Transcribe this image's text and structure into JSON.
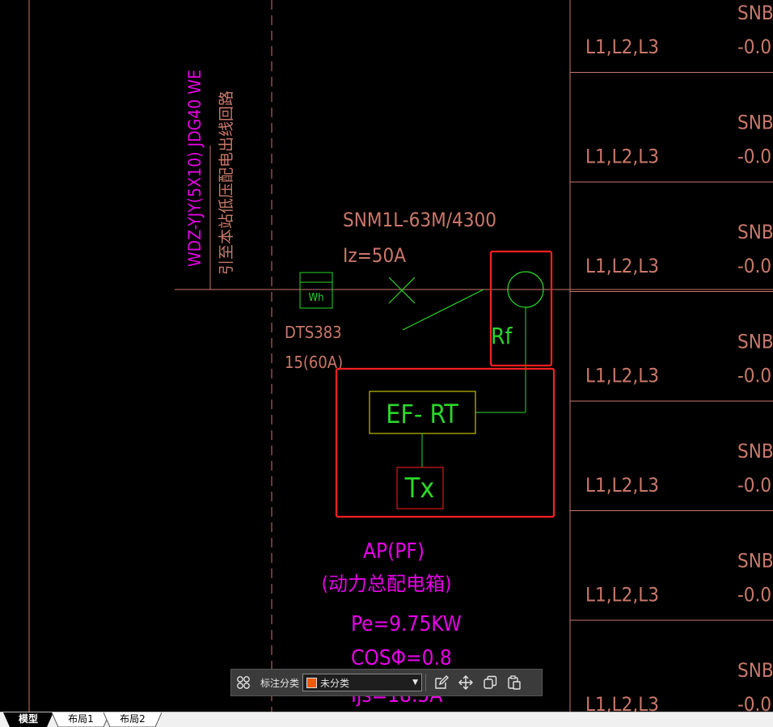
{
  "drawing": {
    "feeder_cable": "WDZ-YJY(5X10) JDG40 WE",
    "feeder_note": "引至本站低压配电出线回路",
    "breaker_model": "SNM1L-63M/4300",
    "breaker_current": "Iz=50A",
    "meter_symbol": "Wh",
    "meter_model": "DTS383",
    "meter_rating": "15(60A)",
    "rf_label": "Rf",
    "efrt_label": "EF- RT",
    "tx_label": "Tx",
    "panel_name": "AP(PF)",
    "panel_desc": "(动力总配电箱)",
    "pe_value": "Pe=9.75KW",
    "cos_value": "COSΦ=0.8",
    "ijs_value": "Ijs=18.5A",
    "branch_rows": [
      {
        "phase": "L1,L2,L3",
        "top": "SNB",
        "bottom": "-0.0"
      },
      {
        "phase": "L1,L2,L3",
        "top": "SNB",
        "bottom": "-0.0"
      },
      {
        "phase": "L1,L2,L3",
        "top": "SNB",
        "bottom": "-0.0"
      },
      {
        "phase": "L1,L2,L3",
        "top": "SNB",
        "bottom": "-0.0"
      },
      {
        "phase": "L1,L2,L3",
        "top": "SNB",
        "bottom": "-0.0"
      },
      {
        "phase": "L1,L2,L3",
        "top": "SNB",
        "bottom": "-0.0"
      },
      {
        "phase": "L1,L2,L3",
        "top": "SNB",
        "bottom": "-0.0"
      }
    ]
  },
  "colors": {
    "background": "#000000",
    "magenta": "#e600e6",
    "brown": "#c8786a",
    "green": "#2bd62b",
    "yellow": "#e6e600",
    "highlight": "#ff2020",
    "swatch": "#f05a0a"
  },
  "toolbar": {
    "grid_icon": "grid-icon",
    "label": "标注分类",
    "category_value": "未分类",
    "edit_icon": "edit-icon",
    "move_icon": "move-icon",
    "copy_icon": "copy-icon",
    "paste_icon": "paste-icon"
  },
  "tabs": [
    {
      "label": "模型",
      "active": true
    },
    {
      "label": "布局1",
      "active": false
    },
    {
      "label": "布局2",
      "active": false
    }
  ]
}
